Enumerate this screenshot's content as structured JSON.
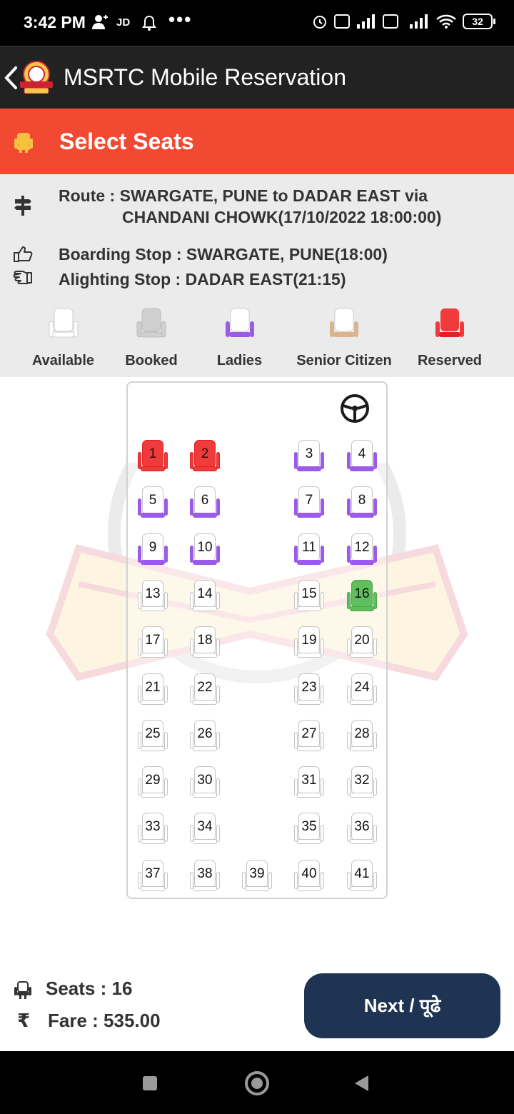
{
  "status_bar": {
    "time": "3:42 PM",
    "carrier_label": "JD",
    "dots": "•••",
    "battery": "32"
  },
  "app_bar": {
    "title": "MSRTC Mobile Reservation"
  },
  "header": {
    "title": "Select Seats"
  },
  "trip": {
    "route_line1": "Route : SWARGATE, PUNE to DADAR EAST via",
    "route_line2": "CHANDANI CHOWK(17/10/2022 18:00:00)",
    "boarding": "Boarding Stop : SWARGATE, PUNE(18:00)",
    "alighting": "Alighting Stop : DADAR EAST(21:15)"
  },
  "legend": [
    {
      "label": "Available",
      "color": "#ffffff"
    },
    {
      "label": "Booked",
      "color": "#cfcfcf"
    },
    {
      "label": "Ladies",
      "color": "#9a5ce6"
    },
    {
      "label": "Senior Citizen",
      "color": "#d9b48f"
    },
    {
      "label": "Reserved",
      "color": "#ef3b3b"
    }
  ],
  "seats": [
    {
      "no": "1",
      "status": "reserved"
    },
    {
      "no": "2",
      "status": "reserved"
    },
    {
      "no": "3",
      "status": "ladies"
    },
    {
      "no": "4",
      "status": "ladies"
    },
    {
      "no": "5",
      "status": "ladies"
    },
    {
      "no": "6",
      "status": "ladies"
    },
    {
      "no": "7",
      "status": "ladies"
    },
    {
      "no": "8",
      "status": "ladies"
    },
    {
      "no": "9",
      "status": "ladies"
    },
    {
      "no": "10",
      "status": "ladies"
    },
    {
      "no": "11",
      "status": "ladies"
    },
    {
      "no": "12",
      "status": "ladies"
    },
    {
      "no": "13",
      "status": "available"
    },
    {
      "no": "14",
      "status": "available"
    },
    {
      "no": "15",
      "status": "available"
    },
    {
      "no": "16",
      "status": "selected"
    },
    {
      "no": "17",
      "status": "available"
    },
    {
      "no": "18",
      "status": "available"
    },
    {
      "no": "19",
      "status": "available"
    },
    {
      "no": "20",
      "status": "available"
    },
    {
      "no": "21",
      "status": "available"
    },
    {
      "no": "22",
      "status": "available"
    },
    {
      "no": "23",
      "status": "available"
    },
    {
      "no": "24",
      "status": "available"
    },
    {
      "no": "25",
      "status": "available"
    },
    {
      "no": "26",
      "status": "available"
    },
    {
      "no": "27",
      "status": "available"
    },
    {
      "no": "28",
      "status": "available"
    },
    {
      "no": "29",
      "status": "available"
    },
    {
      "no": "30",
      "status": "available"
    },
    {
      "no": "31",
      "status": "available"
    },
    {
      "no": "32",
      "status": "available"
    },
    {
      "no": "33",
      "status": "available"
    },
    {
      "no": "34",
      "status": "available"
    },
    {
      "no": "35",
      "status": "available"
    },
    {
      "no": "36",
      "status": "available"
    },
    {
      "no": "37",
      "status": "available"
    },
    {
      "no": "38",
      "status": "available"
    },
    {
      "no": "39",
      "status": "available"
    },
    {
      "no": "40",
      "status": "available"
    },
    {
      "no": "41",
      "status": "available"
    }
  ],
  "summary": {
    "seats": "Seats : 16",
    "rupee_symbol": "₹",
    "fare": "Fare : 535.00",
    "next_label": "Next / पूढे"
  },
  "icons": {
    "back": "chevron-left-icon",
    "steering": "steering-wheel-icon",
    "seat": "seat-icon",
    "route": "signpost-icon",
    "boarding": "thumbs-pointing-icon",
    "alighting": "hand-pointing-icon"
  },
  "colors": {
    "app_bar": "#222222",
    "header": "#f24a32",
    "next_button": "#1f3452",
    "ladies": "#9a5ce6",
    "reserved": "#ef3b3b",
    "selected": "#5fbf5c"
  }
}
